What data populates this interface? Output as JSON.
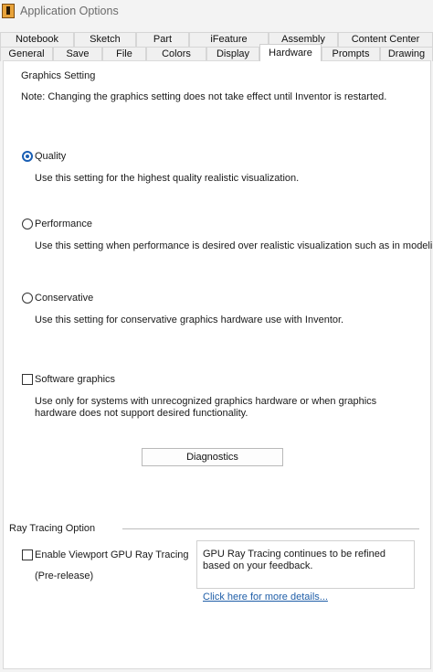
{
  "window": {
    "title": "Application Options",
    "icon": "inventor-app-icon"
  },
  "tabs_row1": [
    "Notebook",
    "Sketch",
    "Part",
    "iFeature",
    "Assembly",
    "Content Center"
  ],
  "tabs_row2": [
    "General",
    "Save",
    "File",
    "Colors",
    "Display",
    "Hardware",
    "Prompts",
    "Drawing"
  ],
  "active_tab": "Hardware",
  "graphics": {
    "heading": "Graphics Setting",
    "note": "Note: Changing the graphics setting does not take effect until Inventor is restarted.",
    "options": [
      {
        "label": "Quality",
        "description": "Use this setting for the highest quality realistic visualization.",
        "selected": true
      },
      {
        "label": "Performance",
        "description": "Use this setting when performance is desired over realistic visualization such as in modeling.",
        "selected": false
      },
      {
        "label": "Conservative",
        "description": "Use this setting for conservative graphics hardware use with Inventor.",
        "selected": false
      }
    ],
    "software": {
      "label": "Software graphics",
      "checked": false,
      "description": "Use only for systems with unrecognized graphics hardware or when graphics hardware does not support desired functionality."
    },
    "diagnostics_button": "Diagnostics"
  },
  "raytracing": {
    "heading": "Ray Tracing Option",
    "checkbox_label": "Enable Viewport GPU Ray Tracing",
    "checkbox_checked": false,
    "pre_release": "(Pre-release)",
    "info_text": "GPU Ray Tracing continues to be refined based on your feedback.",
    "link_text": "Click here for more details..."
  }
}
